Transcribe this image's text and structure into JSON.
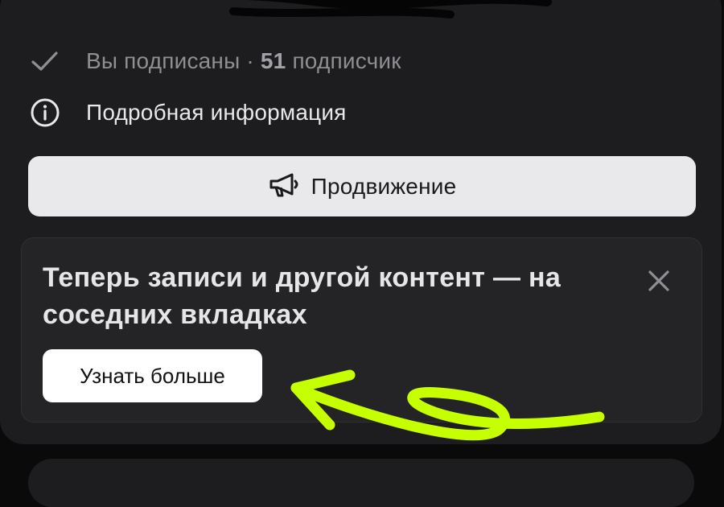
{
  "subscription": {
    "status": "Вы подписаны",
    "separator": "·",
    "count": "51",
    "count_label": "подписчик",
    "icon": "checkmark-icon"
  },
  "info": {
    "label": "Подробная информация",
    "icon": "info-circle-icon"
  },
  "promotion": {
    "label": "Продвижение",
    "icon": "megaphone-icon"
  },
  "banner": {
    "title": "Теперь записи и другой контент — на соседних вкладках",
    "button_label": "Узнать больше",
    "close_icon": "close-icon"
  },
  "annotation": {
    "arrow_color": "#c6ff00"
  },
  "colors": {
    "background": "#0a0a0a",
    "card": "#1d1d1f",
    "banner": "#242426",
    "primary_button": "#e9e9ec",
    "accent": "#c6ff00"
  }
}
